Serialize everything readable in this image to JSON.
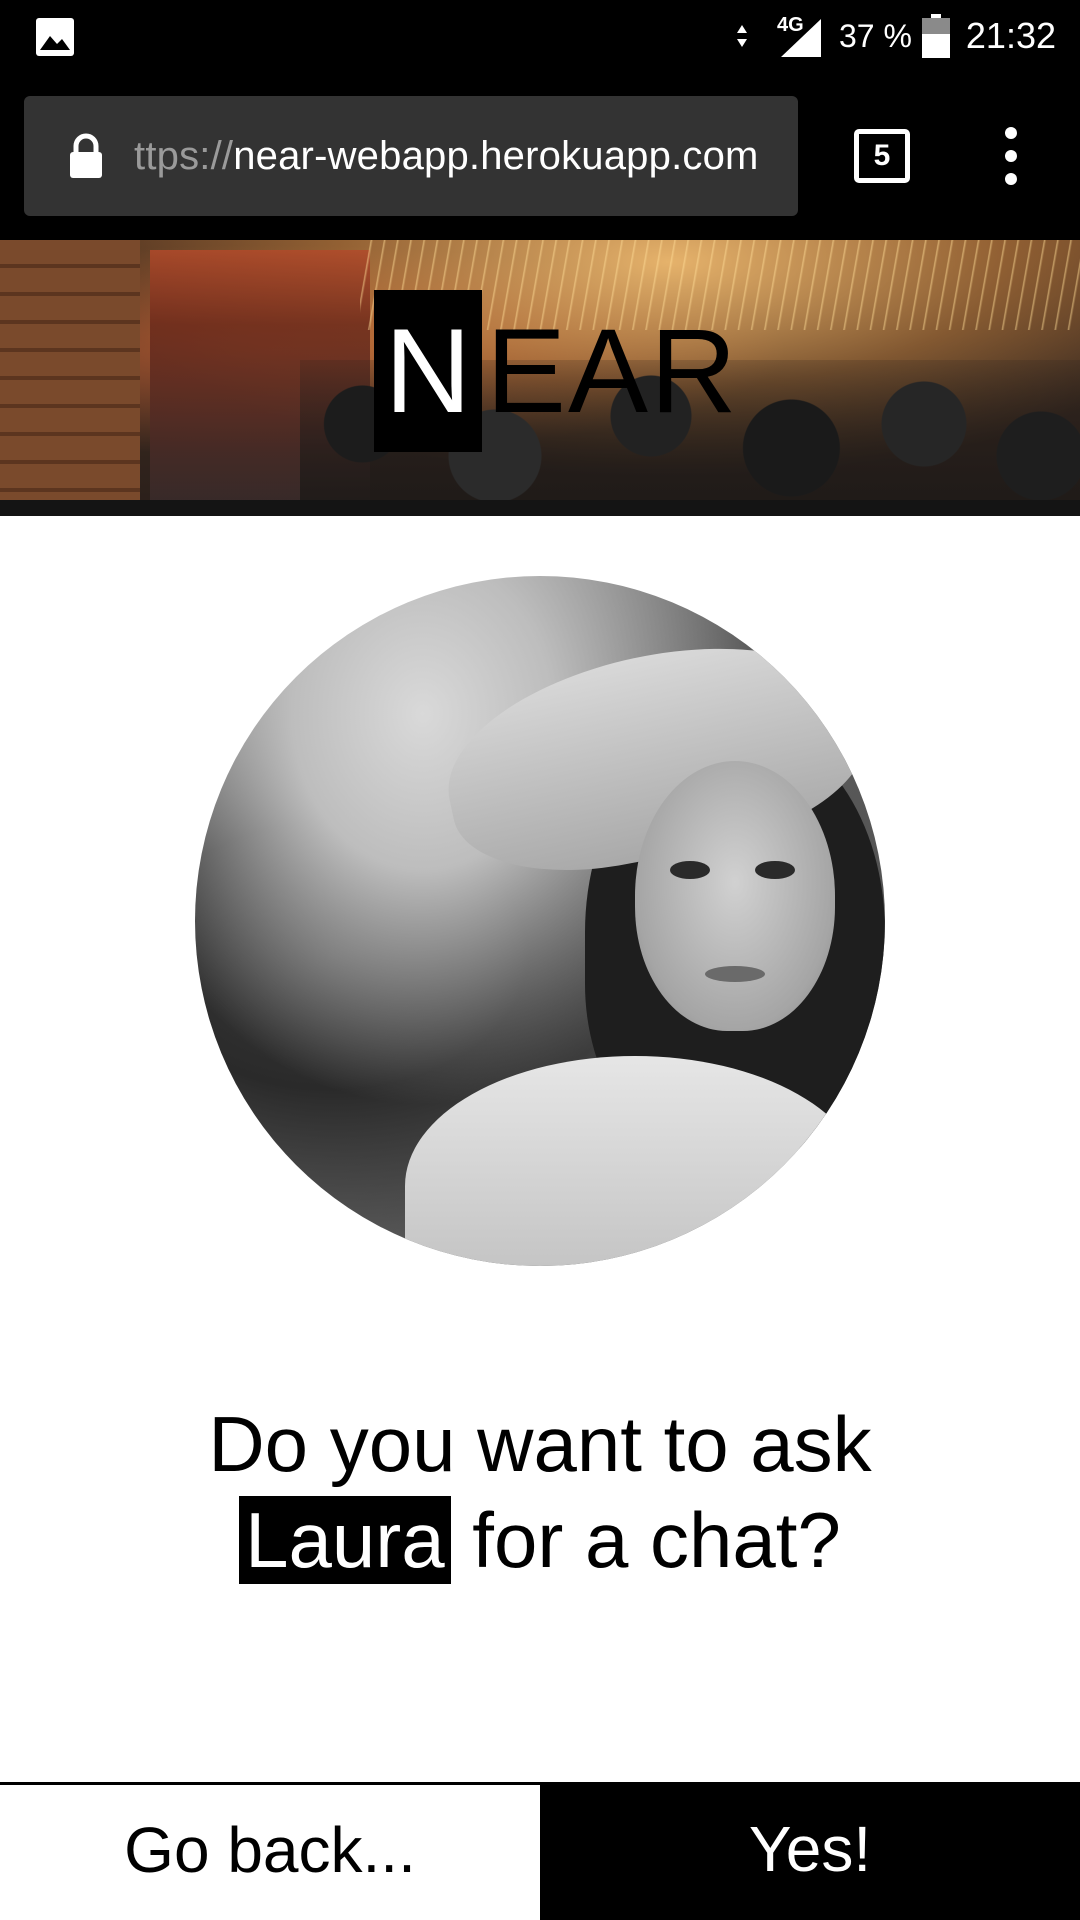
{
  "status_bar": {
    "left_icon": "gallery-icon",
    "network": "4G",
    "battery": "37 %",
    "time": "21:32"
  },
  "browser": {
    "url_prefix": "ttps://",
    "url_domain": "near-webapp.herokuapp.com",
    "tab_count": "5",
    "lock_icon": "lock-icon",
    "menu_icon": "more-vert-icon"
  },
  "header": {
    "logo_first_letter": "N",
    "logo_rest": "EAR"
  },
  "prompt": {
    "before_name": "Do you want to ask",
    "name": "Laura",
    "after_name": "for a chat?"
  },
  "actions": {
    "back_label": "Go back...",
    "confirm_label": "Yes!"
  },
  "colors": {
    "background": "#ffffff",
    "primary": "#000000",
    "url_box": "#333333"
  }
}
